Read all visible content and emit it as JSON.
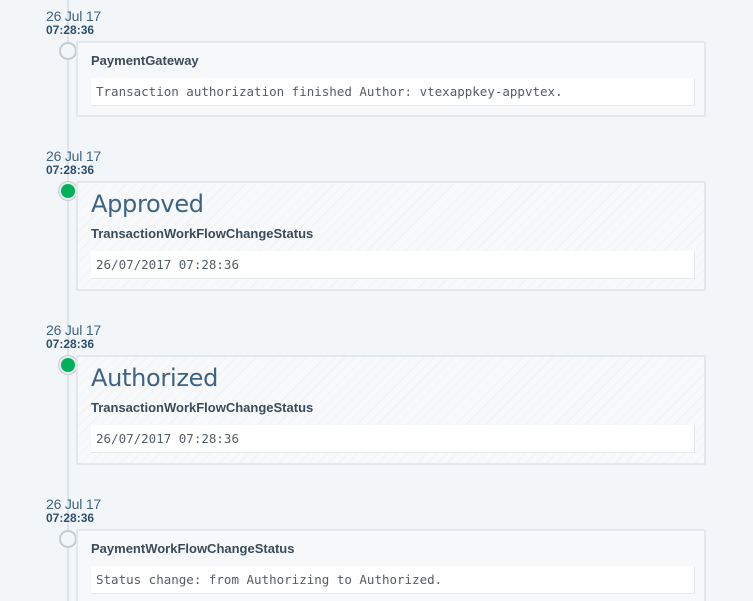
{
  "events": [
    {
      "date": "26 Jul 17",
      "time": "07:28:36",
      "status": "",
      "source": "PaymentGateway",
      "message": "Transaction authorization finished Author: vtexappkey-appvtex.",
      "dot": "neutral"
    },
    {
      "date": "26 Jul 17",
      "time": "07:28:36",
      "status": "Approved",
      "source": "TransactionWorkFlowChangeStatus",
      "message": "26/07/2017 07:28:36",
      "dot": "success"
    },
    {
      "date": "26 Jul 17",
      "time": "07:28:36",
      "status": "Authorized",
      "source": "TransactionWorkFlowChangeStatus",
      "message": "26/07/2017 07:28:36",
      "dot": "success"
    },
    {
      "date": "26 Jul 17",
      "time": "07:28:36",
      "status": "",
      "source": "PaymentWorkFlowChangeStatus",
      "message": "Status change: from Authorizing to Authorized.",
      "dot": "neutral"
    }
  ],
  "colors": {
    "success_dot": "#00b15a",
    "neutral_dot_border": "#c6ccd3",
    "accent_text": "#3f6383"
  }
}
